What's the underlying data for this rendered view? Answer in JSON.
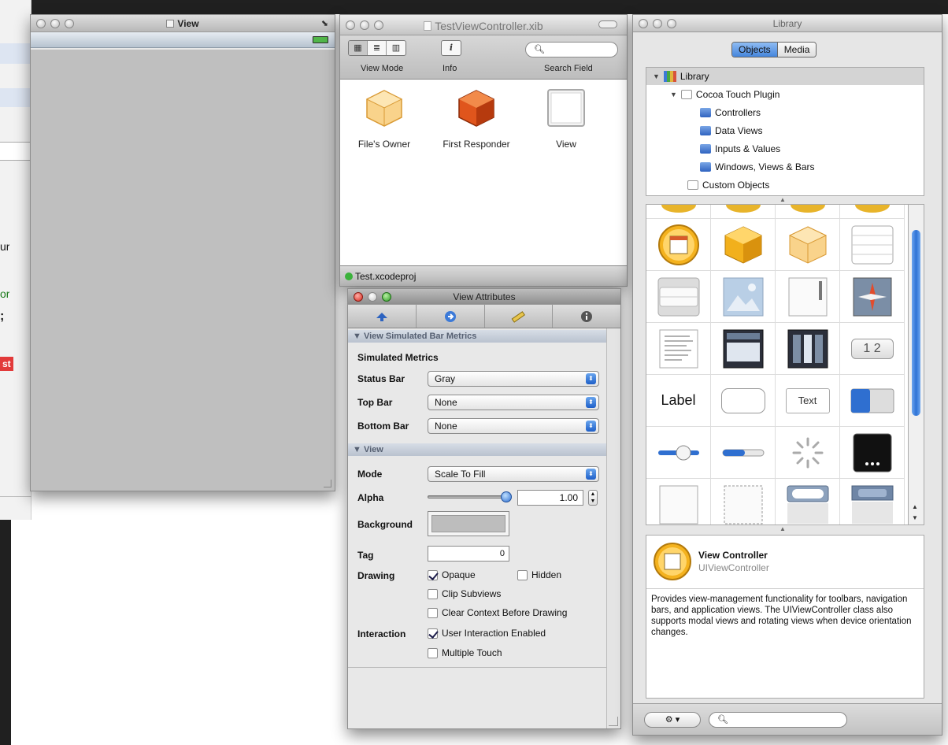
{
  "background": {
    "fragments": [
      {
        "text": "ur",
        "color": "#111111"
      },
      {
        "text": "or",
        "color": "#1a7a1a"
      },
      {
        "text": ";",
        "color": "#111111"
      },
      {
        "text": "st",
        "color": "#ffffff"
      }
    ]
  },
  "view_window": {
    "title": "View"
  },
  "xib_window": {
    "title": "TestViewController.xib",
    "toolbar": {
      "view_mode_label": "View Mode",
      "info_label": "Info",
      "search_label": "Search Field",
      "search_value": "",
      "info_icon": "i"
    },
    "objects": [
      {
        "name": "File's Owner",
        "icon": "translucent-cube-icon"
      },
      {
        "name": "First Responder",
        "icon": "red-cube-icon"
      },
      {
        "name": "View",
        "icon": "view-square-icon"
      }
    ],
    "footer": "Test.xcodeproj"
  },
  "attributes_window": {
    "title": "View Attributes",
    "section_bar_metrics": "▼ View Simulated Bar Metrics",
    "simulated_metrics_label": "Simulated Metrics",
    "status_bar": {
      "label": "Status Bar",
      "value": "Gray"
    },
    "top_bar": {
      "label": "Top Bar",
      "value": "None"
    },
    "bottom_bar": {
      "label": "Bottom Bar",
      "value": "None"
    },
    "section_view": "▼ View",
    "mode": {
      "label": "Mode",
      "value": "Scale To Fill"
    },
    "alpha": {
      "label": "Alpha",
      "value": "1.00",
      "level": 1.0
    },
    "background": {
      "label": "Background",
      "color": "#bdbdbd"
    },
    "tag": {
      "label": "Tag",
      "value": "0"
    },
    "drawing_label": "Drawing",
    "opaque": {
      "label": "Opaque",
      "checked": true
    },
    "hidden": {
      "label": "Hidden",
      "checked": false
    },
    "clip_subviews": {
      "label": "Clip Subviews",
      "checked": false
    },
    "clear_context": {
      "label": "Clear Context Before Drawing",
      "checked": false
    },
    "interaction_label": "Interaction",
    "user_interaction": {
      "label": "User Interaction Enabled",
      "checked": true
    },
    "multiple_touch": {
      "label": "Multiple Touch",
      "checked": false
    }
  },
  "library_window": {
    "title": "Library",
    "tabs": [
      "Objects",
      "Media"
    ],
    "tree": [
      {
        "label": "Library",
        "level": 0
      },
      {
        "label": "Cocoa Touch Plugin",
        "level": 1
      },
      {
        "label": "Controllers",
        "level": 2
      },
      {
        "label": "Data Views",
        "level": 2
      },
      {
        "label": "Inputs & Values",
        "level": 2
      },
      {
        "label": "Windows, Views & Bars",
        "level": 2
      },
      {
        "label": "Custom Objects",
        "level": 1
      }
    ],
    "grid_items": [
      {
        "name": "calendar-controller-icon"
      },
      {
        "name": "gold-cube-icon"
      },
      {
        "name": "translucent-cube-icon"
      },
      {
        "name": "table-view-icon"
      },
      {
        "name": "grouped-table-icon"
      },
      {
        "name": "image-view-icon"
      },
      {
        "name": "view-icon"
      },
      {
        "name": "web-view-icon"
      },
      {
        "name": "text-view-icon"
      },
      {
        "name": "navigation-bar-icon"
      },
      {
        "name": "toolbar-icon"
      },
      {
        "name": "segmented-control-icon",
        "text": "1 2"
      },
      {
        "name": "label-icon",
        "text": "Label"
      },
      {
        "name": "rounded-rect-button-icon"
      },
      {
        "name": "text-field-icon",
        "text": "Text"
      },
      {
        "name": "switch-icon"
      },
      {
        "name": "slider-icon"
      },
      {
        "name": "progress-view-icon"
      },
      {
        "name": "activity-indicator-icon"
      },
      {
        "name": "page-control-icon"
      },
      {
        "name": "blank-view-icon"
      },
      {
        "name": "dashed-view-icon"
      },
      {
        "name": "search-bar-icon"
      },
      {
        "name": "tab-bar-icon"
      }
    ],
    "description": {
      "title": "View Controller",
      "subtitle": "UIViewController",
      "text": "Provides view-management functionality for toolbars, navigation bars, and application views. The UIViewController class also supports modal views and rotating views when device orientation changes."
    },
    "search_value": ""
  }
}
